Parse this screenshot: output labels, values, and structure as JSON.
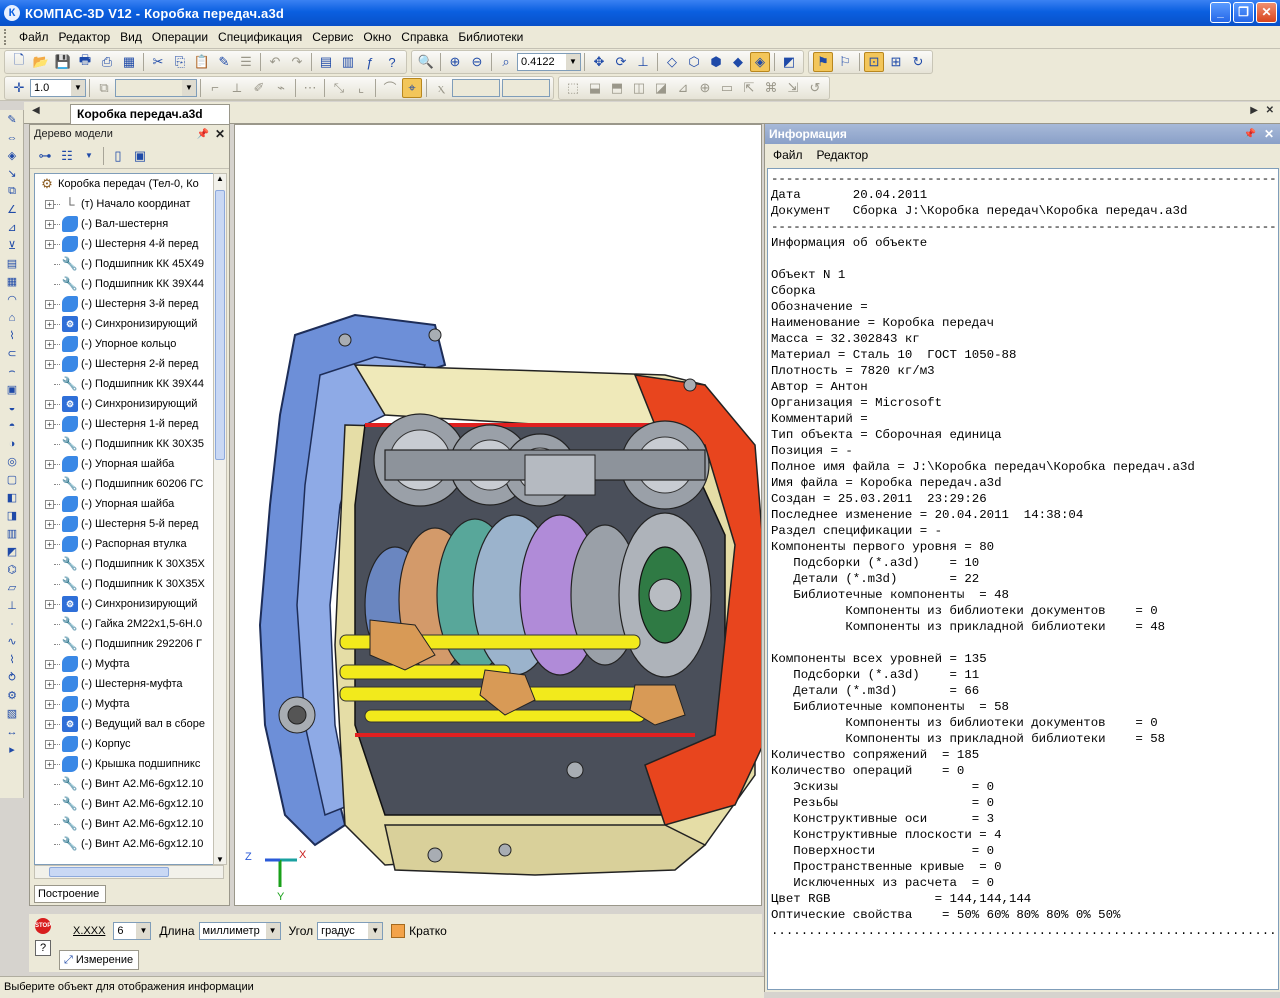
{
  "window": {
    "title": "КОМПАС-3D V12 - Коробка передач.a3d",
    "app_icon": "К"
  },
  "menu": [
    "Файл",
    "Редактор",
    "Вид",
    "Операции",
    "Спецификация",
    "Сервис",
    "Окно",
    "Справка",
    "Библиотеки"
  ],
  "toolbar": {
    "zoom_value": "0.4122",
    "step_value": "1.0"
  },
  "doc_tab": "Коробка передач.a3d",
  "tree": {
    "title": "Дерево модели",
    "root": "Коробка передач (Тел-0, Ко",
    "items": [
      {
        "label": "(т) Начало координат",
        "icon": "origin",
        "expand": true
      },
      {
        "label": "(-) Вал-шестерня",
        "icon": "part",
        "expand": true
      },
      {
        "label": "(-) Шестерня 4-й перед",
        "icon": "part",
        "expand": true
      },
      {
        "label": "(-) Подшипник КК 45Х49",
        "icon": "lib",
        "expand": false
      },
      {
        "label": "(-) Подшипник КК 39Х44",
        "icon": "lib",
        "expand": false
      },
      {
        "label": "(-) Шестерня 3-й перед",
        "icon": "part",
        "expand": true
      },
      {
        "label": "(-) Синхронизирующий",
        "icon": "asm",
        "expand": true
      },
      {
        "label": "(-) Упорное кольцо",
        "icon": "part",
        "expand": true
      },
      {
        "label": "(-) Шестерня 2-й перед",
        "icon": "part",
        "expand": true
      },
      {
        "label": "(-) Подшипник КК 39Х44",
        "icon": "lib",
        "expand": false
      },
      {
        "label": "(-) Синхронизирующий",
        "icon": "asm",
        "expand": true
      },
      {
        "label": "(-) Шестерня 1-й перед",
        "icon": "part",
        "expand": true
      },
      {
        "label": "(-) Подшипник КК 30Х35",
        "icon": "lib",
        "expand": false
      },
      {
        "label": "(-) Упорная шайба",
        "icon": "part",
        "expand": true
      },
      {
        "label": "(-) Подшипник 60206 ГС",
        "icon": "lib",
        "expand": false
      },
      {
        "label": "(-) Упорная шайба",
        "icon": "part",
        "expand": true
      },
      {
        "label": "(-) Шестерня 5-й перед",
        "icon": "part",
        "expand": true
      },
      {
        "label": "(-) Распорная втулка",
        "icon": "part",
        "expand": true
      },
      {
        "label": "(-) Подшипник К 30Х35Х",
        "icon": "lib",
        "expand": false
      },
      {
        "label": "(-) Подшипник К 30Х35Х",
        "icon": "lib",
        "expand": false
      },
      {
        "label": "(-) Синхронизирующий",
        "icon": "asm",
        "expand": true
      },
      {
        "label": "(-) Гайка 2М22х1,5-6Н.0",
        "icon": "lib",
        "expand": false
      },
      {
        "label": "(-) Подшипник 292206 Г",
        "icon": "lib",
        "expand": false
      },
      {
        "label": "(-) Муфта",
        "icon": "part",
        "expand": true
      },
      {
        "label": "(-) Шестерня-муфта",
        "icon": "part",
        "expand": true
      },
      {
        "label": "(-) Муфта",
        "icon": "part",
        "expand": true
      },
      {
        "label": "(-) Ведущий вал в сборе",
        "icon": "asm",
        "expand": true
      },
      {
        "label": "(-) Корпус",
        "icon": "part",
        "expand": true
      },
      {
        "label": "(-) Крышка подшипникс",
        "icon": "part",
        "expand": true
      },
      {
        "label": "(-) Винт А2.М6-6gх12.10",
        "icon": "lib",
        "expand": false
      },
      {
        "label": "(-) Винт А2.М6-6gх12.10",
        "icon": "lib",
        "expand": false
      },
      {
        "label": "(-) Винт А2.М6-6gх12.10",
        "icon": "lib",
        "expand": false
      },
      {
        "label": "(-) Винт А2.М6-6gх12.10",
        "icon": "lib",
        "expand": false
      }
    ],
    "tab": "Построение"
  },
  "info": {
    "title": "Информация",
    "menu": [
      "Файл",
      "Редактор"
    ],
    "lines": [
      "-----------------------------------------------------------------------------",
      "Дата       20.04.2011",
      "Документ   Сборка J:\\Коробка передач\\Коробка передач.a3d",
      "-----------------------------------------------------------------------------",
      "Информация об объекте",
      "",
      "Объект N 1",
      "Сборка",
      "Обозначение =",
      "Наименование = Коробка передач",
      "Масса = 32.302843 кг",
      "Материал = Сталь 10  ГОСТ 1050-88",
      "Плотность = 7820 кг/м3",
      "Автор = Антон",
      "Организация = Microsoft",
      "Комментарий =",
      "Тип объекта = Сборочная единица",
      "Позиция = -",
      "Полное имя файла = J:\\Коробка передач\\Коробка передач.a3d",
      "Имя файла = Коробка передач.a3d",
      "Создан = 25.03.2011  23:29:26",
      "Последнее изменение = 20.04.2011  14:38:04",
      "Раздел спецификации = -",
      "Компоненты первого уровня = 80",
      "   Подсборки (*.a3d)    = 10",
      "   Детали (*.m3d)       = 22",
      "   Библиотечные компоненты  = 48",
      "          Компоненты из библиотеки документов    = 0",
      "          Компоненты из прикладной библиотеки    = 48",
      "",
      "Компоненты всех уровней = 135",
      "   Подсборки (*.a3d)    = 11",
      "   Детали (*.m3d)       = 66",
      "   Библиотечные компоненты  = 58",
      "          Компоненты из библиотеки документов    = 0",
      "          Компоненты из прикладной библиотеки    = 58",
      "Количество сопряжений  = 185",
      "Количество операций    = 0",
      "   Эскизы                  = 0",
      "   Резьбы                  = 0",
      "   Конструктивные оси      = 3",
      "   Конструктивные плоскости = 4",
      "   Поверхности             = 0",
      "   Пространственные кривые  = 0",
      "   Исключенных из расчета  = 0",
      "Цвет RGB              = 144,144,144",
      "Оптические свойства    = 50% 60% 80% 80% 0% 50%",
      "............................................................................."
    ]
  },
  "measure": {
    "precision_label": "X.XXX",
    "precision_value": "6",
    "length_label": "Длина",
    "length_value": "миллиметр",
    "angle_label": "Угол",
    "angle_value": "градус",
    "brief_label": "Кратко",
    "tab": "Измерение"
  },
  "axes": {
    "x": "X",
    "y": "Y",
    "z": "Z"
  },
  "status": "Выберите объект для отображения информации"
}
